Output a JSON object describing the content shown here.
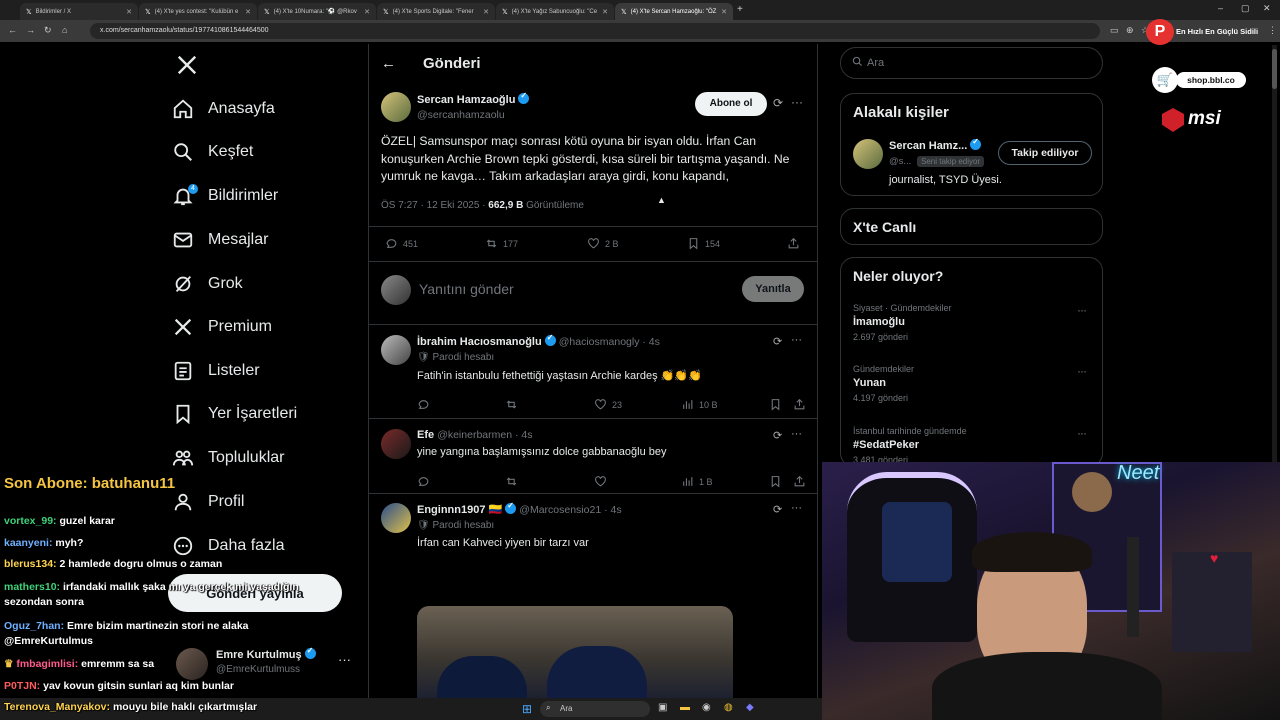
{
  "browser": {
    "tabs": [
      {
        "label": "Bildirimler / X"
      },
      {
        "label": "(4) X'te yes contest: \"Kulübün e"
      },
      {
        "label": "(4) X'te 10Numara: \"⚽ @Rkov"
      },
      {
        "label": "(4) X'te Sports Digitale: \"Fener"
      },
      {
        "label": "(4) X'te Yağız Sabuncuoğlu: \"Ce"
      },
      {
        "label": "(4) X'te Sercan Hamzaoğlu: \"ÖZ"
      }
    ],
    "url": "x.com/sercanhamzaolu/status/1977410861544464500"
  },
  "sidebar": {
    "items": [
      {
        "label": "Anasayfa",
        "icon": "home-icon"
      },
      {
        "label": "Keşfet",
        "icon": "search-icon"
      },
      {
        "label": "Bildirimler",
        "icon": "bell-icon",
        "badge": "4"
      },
      {
        "label": "Mesajlar",
        "icon": "mail-icon"
      },
      {
        "label": "Grok",
        "icon": "grok-icon"
      },
      {
        "label": "Premium",
        "icon": "x-icon"
      },
      {
        "label": "Listeler",
        "icon": "list-icon"
      },
      {
        "label": "Yer İşaretleri",
        "icon": "bookmark-icon"
      },
      {
        "label": "Topluluklar",
        "icon": "people-icon"
      },
      {
        "label": "Profil",
        "icon": "profile-icon"
      },
      {
        "label": "Daha fazla",
        "icon": "more-icon"
      }
    ],
    "post_button": "Gönderi yayınla",
    "account": {
      "name": "Emre Kurtulmuş",
      "handle": "@EmreKurtulmuss"
    }
  },
  "post": {
    "header": "Gönderi",
    "author": "Sercan Hamzaoğlu",
    "handle": "@sercanhamzaolu",
    "follow_btn": "Abone ol",
    "text": "ÖZEL| Samsunspor maçı sonrası kötü oyuna bir isyan oldu. İrfan Can konuşurken Archie Brown tepki gösterdi, kısa süreli bir tartışma yaşandı. Ne yumruk ne kavga… Takım arkadaşları araya girdi, konu kapandı,",
    "time": "ÖS 7:27 · 12 Eki 2025 · ",
    "views": "662,9 B",
    "views_label": "Görüntüleme",
    "replies": "451",
    "reposts": "177",
    "likes": "2 B",
    "bookmarks": "154",
    "reply_placeholder": "Yanıtını gönder",
    "reply_btn": "Yanıtla"
  },
  "replies": [
    {
      "name": "İbrahim Hacıosmanoğlu",
      "handle": "@haciosmanogly · 4s",
      "tag": "Parodi hesabı",
      "text": "Fatih'in istanbulu fethettiği yaştasın Archie kardeş 👏👏👏",
      "replies": "",
      "reposts": "",
      "likes": "23",
      "views": "10 B"
    },
    {
      "name": "Efe",
      "handle": "@keinerbarmen · 4s",
      "tag": "",
      "text": "yine yangına başlamışsınız dolce gabbanaoğlu bey",
      "replies": "",
      "reposts": "",
      "likes": "",
      "views": "1 B"
    },
    {
      "name": "Enginnn1907",
      "handle": "@Marcosensio21 · 4s",
      "tag": "Parodi hesabı",
      "text": "İrfan can Kahveci yiyen bir tarzı var",
      "flag": "🇨🇴"
    }
  ],
  "right": {
    "search_placeholder": "Ara",
    "related_title": "Alakalı kişiler",
    "related_name": "Sercan Hamz...",
    "related_handle": "@s...",
    "related_follows_you": "Seni takip ediyor",
    "related_btn": "Takip ediliyor",
    "related_bio": "journalist, TSYD Üyesi.",
    "live_title": "X'te Canlı",
    "trends_title": "Neler oluyor?",
    "trends": [
      {
        "cat": "Siyaset · Gündemdekiler",
        "title": "İmamoğlu",
        "count": "2.697 gönderi"
      },
      {
        "cat": "Gündemdekiler",
        "title": "Yunan",
        "count": "4.197 gönderi"
      },
      {
        "cat": "İstanbul tarihinde gündemde",
        "title": "#SedatPeker",
        "count": "3.481 gönderi"
      }
    ]
  },
  "overlay": {
    "sub_text": "Son Abone: batuhanu11",
    "sponsor1": "En Hızlı En Güçlü Sidili",
    "sponsor2": "shop.bbl.co",
    "sponsor3": "msi",
    "chat": [
      {
        "user": "vortex_99:",
        "msg": "guzel karar",
        "color": "#3fd17a"
      },
      {
        "user": "kaanyeni:",
        "msg": "myh?",
        "color": "#6fb1ff"
      },
      {
        "user": "blerus134:",
        "msg": "2 hamlede dogru olmus o zaman",
        "color": "#ffd54f"
      },
      {
        "user": "mathers10:",
        "msg": "irfandaki mallık şaka mı ya gerçek mi yaşadığın sezondan sonra",
        "color": "#3fd17a"
      },
      {
        "user": "Oguz_7han:",
        "msg": "Emre bizim martinezin stori ne alaka @EmreKurtulmus",
        "color": "#6fb1ff"
      },
      {
        "user": "fmbagimlisi:",
        "msg": "emremm sa sa",
        "color": "#ff5c8a"
      },
      {
        "user": "P0TJN:",
        "msg": "yav kovun gitsin sunlari aq kim bunlar",
        "color": "#ff5c5c"
      },
      {
        "user": "Terenova_Manyakov:",
        "msg": "mouyu bile haklı çıkartmışlar",
        "color": "#ffd54f"
      }
    ]
  },
  "taskbar": {
    "search": "Ara"
  }
}
